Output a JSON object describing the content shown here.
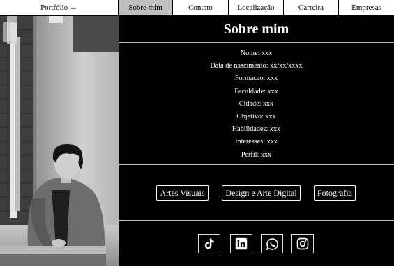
{
  "nav": {
    "items": [
      {
        "label": "Portfólio →"
      },
      {
        "label": "Sobre mim"
      },
      {
        "label": "Contato"
      },
      {
        "label": "Localização"
      },
      {
        "label": "Carreira"
      },
      {
        "label": "Empresas"
      }
    ],
    "active": "Sobre mim"
  },
  "about": {
    "title": "Sobre mim",
    "lines": [
      "Nome: xxx",
      "Data de nascimento: xx/xx/xxxx",
      "Formacao: xxx",
      "Faculdade: xxx",
      "Cidade: xxx",
      "Objetivo: xxx",
      "Habilidades: xxx",
      "Interesses: xxx",
      "Perfil: xxx"
    ]
  },
  "categories": [
    "Artes Visuais",
    "Design e Arte Digital",
    "Fotografia"
  ],
  "social": [
    "tiktok-icon",
    "linkedin-icon",
    "whatsapp-icon",
    "instagram-icon"
  ],
  "colors": {
    "background": "#000000",
    "nav_background": "#ffffff",
    "nav_active": "#bfbfbf",
    "text": "#ffffff"
  }
}
